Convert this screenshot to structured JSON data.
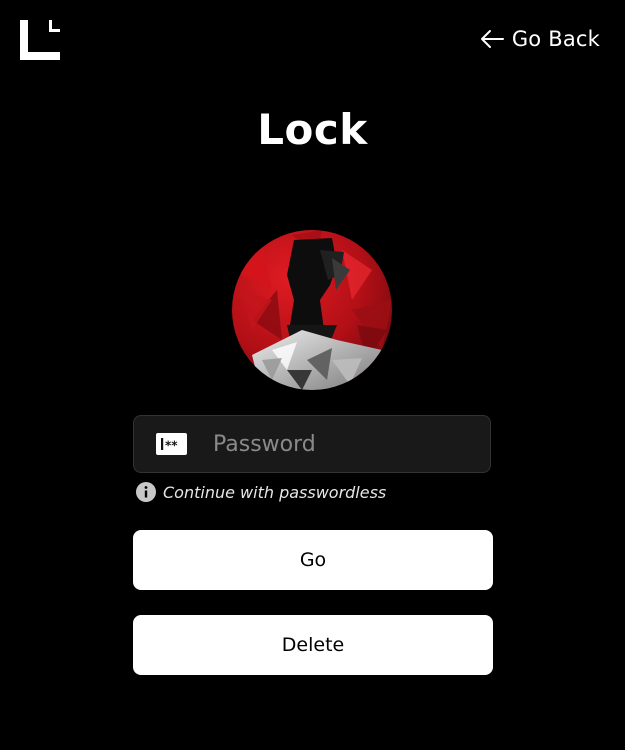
{
  "header": {
    "logo_icon": "corner-bracket-logo-icon",
    "back_icon": "arrow-left-icon",
    "back_label": "Go Back"
  },
  "page": {
    "title": "Lock"
  },
  "avatar": {
    "description_icon": "geometric-avatar",
    "colors": {
      "primary": "#c0121a",
      "dark": "#111111",
      "light": "#d8d8d8"
    }
  },
  "form": {
    "password_icon": "password-key-icon",
    "password_placeholder": "Password",
    "password_value": "",
    "hint_icon": "info-icon",
    "hint_text": "Continue with passwordless",
    "go_label": "Go",
    "delete_label": "Delete"
  }
}
